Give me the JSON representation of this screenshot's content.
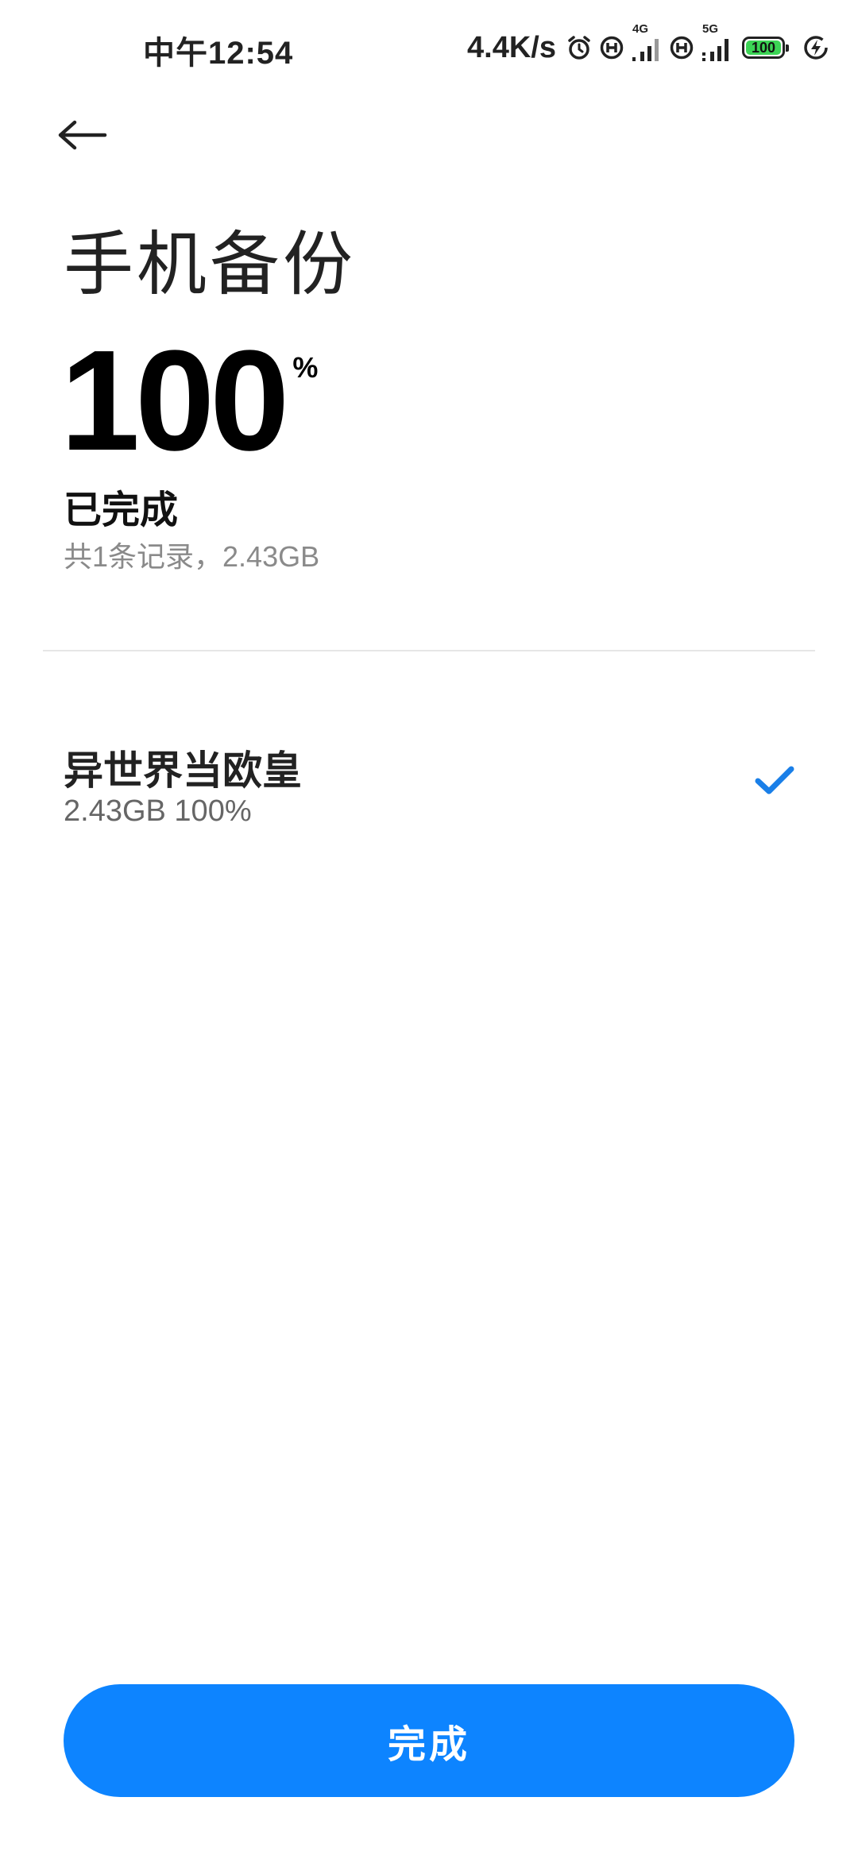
{
  "status_bar": {
    "time": "中午12:54",
    "net_speed": "4.4K/s",
    "sim1_network": "4G",
    "sim2_network": "5G",
    "battery": "100",
    "battery_color": "#3cd455",
    "icons": [
      "alarm-icon",
      "hd-icon",
      "signal-icon",
      "hd-icon",
      "signal-icon",
      "battery-icon",
      "charging-icon"
    ]
  },
  "header": {
    "back_icon": "arrow-left-icon",
    "title": "手机备份"
  },
  "progress": {
    "value": "100",
    "unit": "%",
    "status": "已完成",
    "summary": "共1条记录，2.43GB"
  },
  "records": [
    {
      "name": "异世界当欧皇",
      "detail": "2.43GB 100%",
      "icon": "check-icon"
    }
  ],
  "footer": {
    "done_label": "完成"
  },
  "colors": {
    "accent": "#0d84ff",
    "check": "#1a7fe8"
  }
}
